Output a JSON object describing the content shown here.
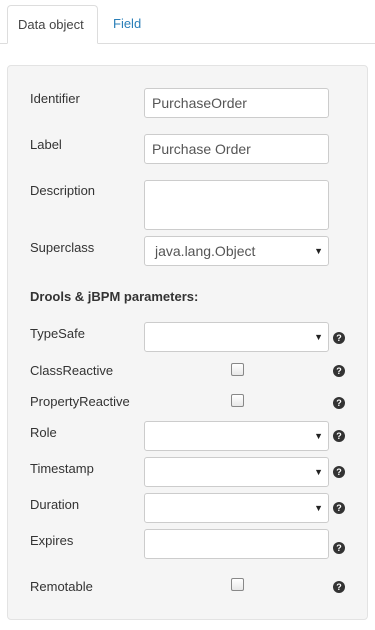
{
  "tabs": [
    {
      "label": "Data object",
      "active": true
    },
    {
      "label": "Field",
      "active": false
    }
  ],
  "form": {
    "identifier": {
      "label": "Identifier",
      "value": "PurchaseOrder"
    },
    "label": {
      "label": "Label",
      "value": "Purchase Order"
    },
    "description": {
      "label": "Description",
      "value": ""
    },
    "superclass": {
      "label": "Superclass",
      "value": "java.lang.Object"
    }
  },
  "section_title": "Drools & jBPM parameters:",
  "params": {
    "typesafe": {
      "label": "TypeSafe",
      "value": ""
    },
    "classreactive": {
      "label": "ClassReactive",
      "checked": false
    },
    "propertyreactive": {
      "label": "PropertyReactive",
      "checked": false
    },
    "role": {
      "label": "Role",
      "value": ""
    },
    "timestamp": {
      "label": "Timestamp",
      "value": ""
    },
    "duration": {
      "label": "Duration",
      "value": ""
    },
    "expires": {
      "label": "Expires",
      "value": ""
    },
    "remotable": {
      "label": "Remotable",
      "checked": false
    }
  },
  "icons": {
    "help": "question-circle-icon",
    "caret": "caret-down-icon"
  },
  "colors": {
    "link": "#2a7fb8",
    "panel_bg": "#f5f5f5",
    "border": "#cccccc"
  }
}
